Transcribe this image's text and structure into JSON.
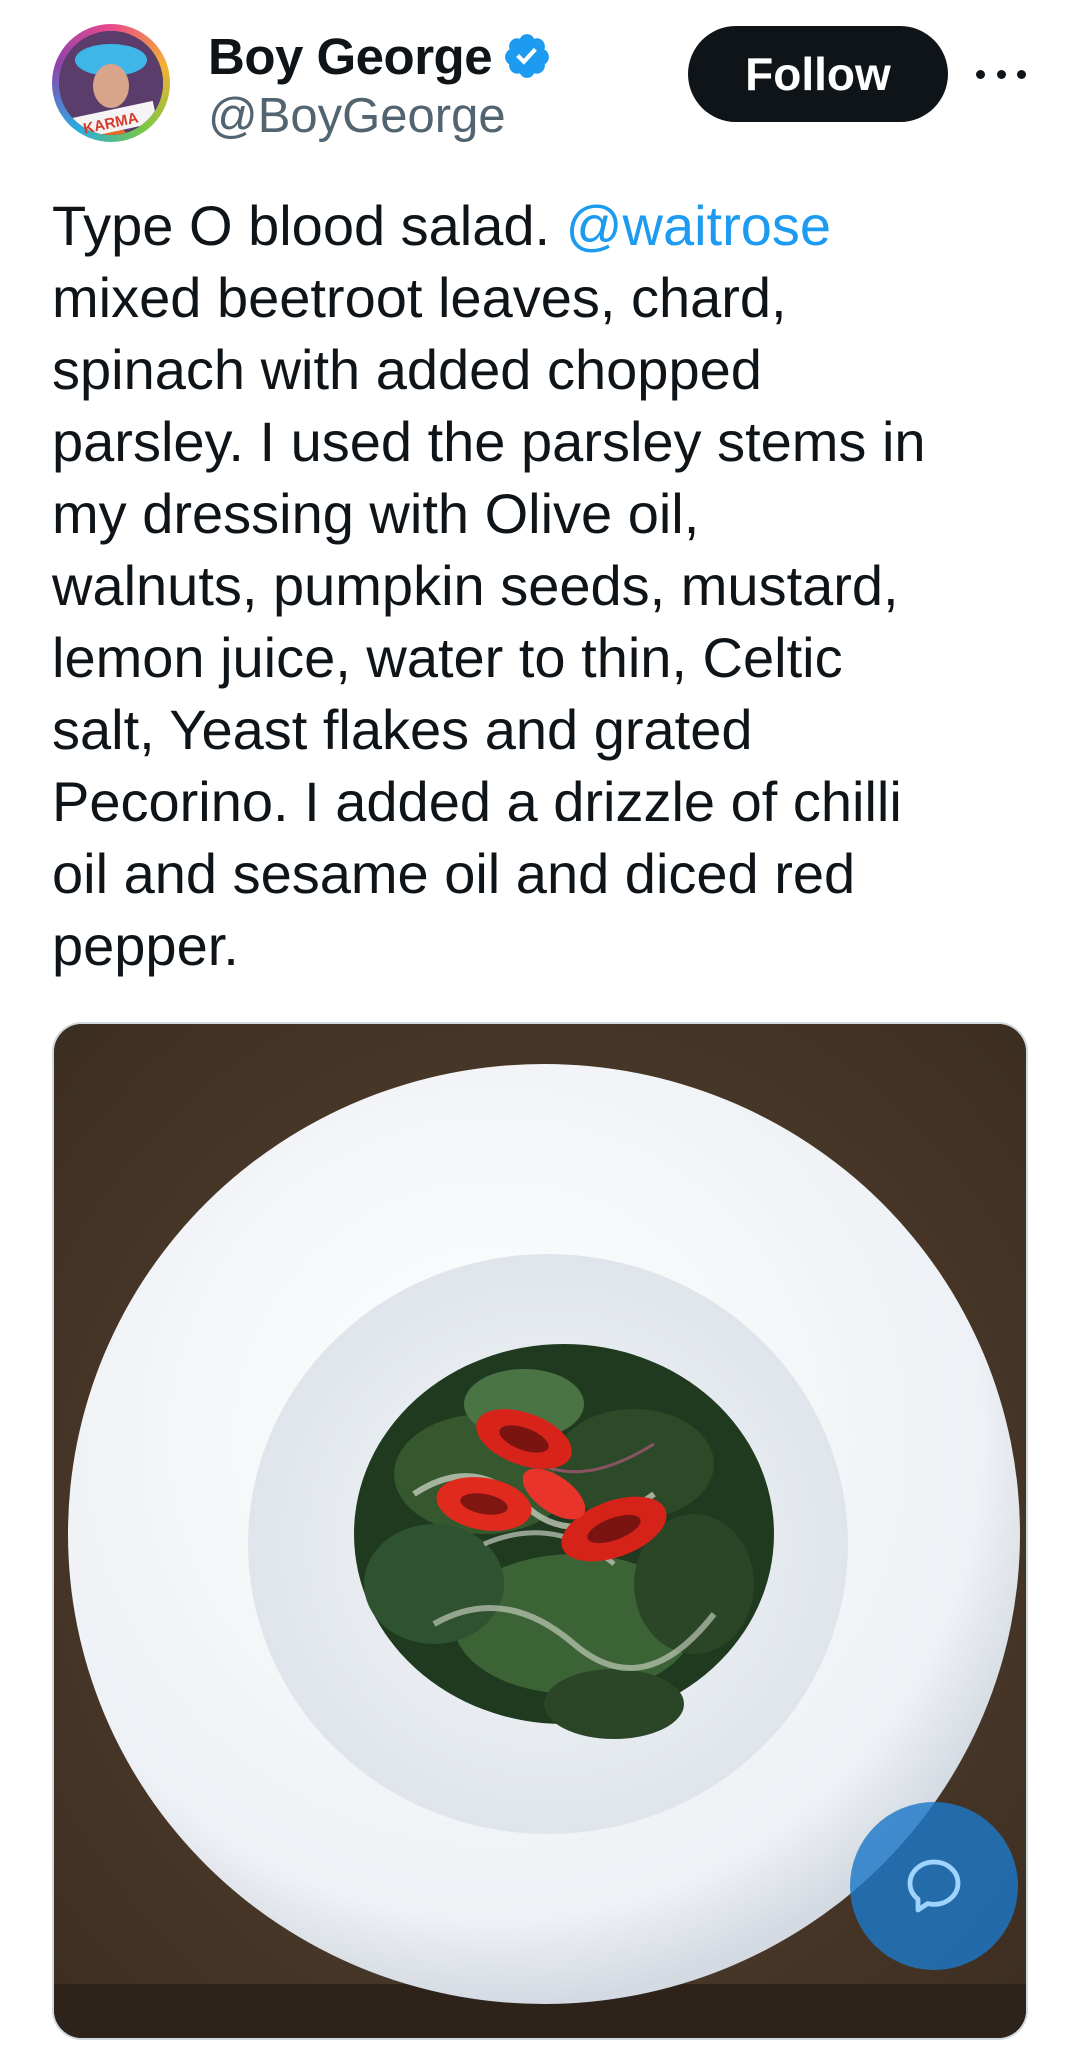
{
  "author": {
    "display_name": "Boy George",
    "handle": "@BoyGeorge",
    "avatar_caption": "KARMA",
    "verified": true
  },
  "actions": {
    "follow_label": "Follow"
  },
  "tweet": {
    "text_before_mention": "Type O blood salad. ",
    "mention": "@waitrose",
    "text_after_mention": "\nmixed beetroot leaves, chard,\nspinach with added chopped\nparsley. I used the parsley stems in\nmy dressing with Olive oil,\nwalnuts, pumpkin seeds, mustard,\nlemon juice, water to thin, Celtic\nsalt, Yeast flakes and grated\nPecorino. I added a drizzle of chilli\noil and sesame oil and diced red\npepper."
  },
  "colors": {
    "accent": "#1d9bf0",
    "text": "#0f1419",
    "secondary_text": "#536471",
    "follow_bg": "#0f1419"
  },
  "icons": {
    "verified": "verified-badge-icon",
    "more": "more-options-icon",
    "reply": "chat-bubble-icon"
  }
}
